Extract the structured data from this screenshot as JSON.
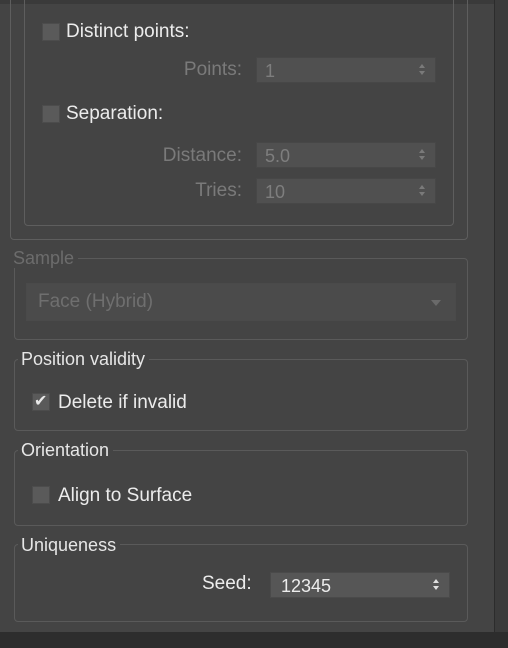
{
  "distribution": {
    "distinct_points": {
      "label": "Distinct points:",
      "checked": false
    },
    "points": {
      "label": "Points:",
      "value": "1"
    },
    "separation": {
      "label": "Separation:",
      "checked": false
    },
    "distance": {
      "label": "Distance:",
      "value": "5.0"
    },
    "tries": {
      "label": "Tries:",
      "value": "10"
    }
  },
  "sample": {
    "legend": "Sample",
    "dropdown_value": "Face (Hybrid)"
  },
  "position_validity": {
    "legend": "Position validity",
    "delete_if_invalid": {
      "label": "Delete if invalid",
      "checked": true,
      "mark": "✔"
    }
  },
  "orientation": {
    "legend": "Orientation",
    "align_to_surface": {
      "label": "Align to Surface",
      "checked": false
    }
  },
  "uniqueness": {
    "legend": "Uniqueness",
    "seed": {
      "label": "Seed:",
      "value": "12345"
    }
  },
  "icons": {
    "spinner": "spinner-arrows-icon",
    "dropdown": "chevron-down-icon",
    "check": "checkmark-icon"
  }
}
